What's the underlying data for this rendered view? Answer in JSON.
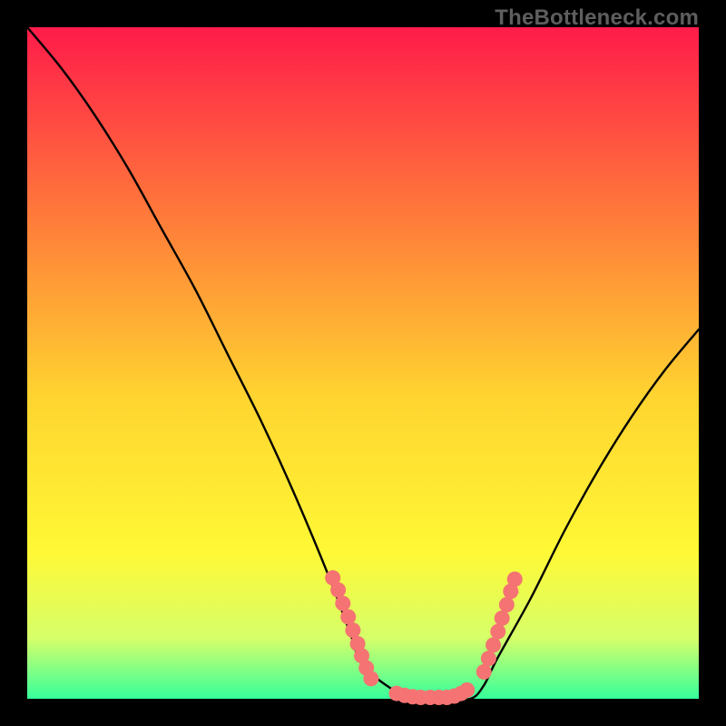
{
  "watermark": "TheBottleneck.com",
  "gradient": {
    "top": "#ff1b4a",
    "upper_mid": "#ff7a3a",
    "mid": "#ffd430",
    "lower_mid": "#fff835",
    "near_bottom": "#d6ff6a",
    "bottom": "#36ff9b"
  },
  "dot_color": "#f57373",
  "chart_data": {
    "type": "line",
    "title": "",
    "xlabel": "",
    "ylabel": "",
    "xlim": [
      0,
      100
    ],
    "ylim": [
      0,
      100
    ],
    "grid": false,
    "legend": false,
    "series": [
      {
        "name": "bottleneck_curve",
        "x": [
          0,
          5,
          10,
          15,
          20,
          25,
          30,
          35,
          40,
          45,
          48,
          50,
          55,
          58,
          60,
          62,
          66,
          68,
          70,
          75,
          80,
          85,
          90,
          95,
          100
        ],
        "y": [
          100,
          94,
          87,
          79,
          70,
          61,
          51,
          41,
          30,
          18,
          10,
          5,
          1,
          0,
          0,
          0,
          0,
          2,
          6,
          15,
          25,
          34,
          42,
          49,
          55
        ]
      }
    ],
    "dots_cluster_left": [
      {
        "x": 45.5,
        "y": 18.0
      },
      {
        "x": 46.3,
        "y": 16.2
      },
      {
        "x": 47.0,
        "y": 14.2
      },
      {
        "x": 47.8,
        "y": 12.2
      },
      {
        "x": 48.5,
        "y": 10.2
      },
      {
        "x": 49.2,
        "y": 8.2
      },
      {
        "x": 49.8,
        "y": 6.4
      },
      {
        "x": 50.5,
        "y": 4.6
      },
      {
        "x": 51.2,
        "y": 3.0
      }
    ],
    "dots_cluster_bottom": [
      {
        "x": 55.0,
        "y": 0.8
      },
      {
        "x": 56.2,
        "y": 0.5
      },
      {
        "x": 57.4,
        "y": 0.3
      },
      {
        "x": 58.6,
        "y": 0.2
      },
      {
        "x": 60.0,
        "y": 0.2
      },
      {
        "x": 61.3,
        "y": 0.2
      },
      {
        "x": 62.5,
        "y": 0.2
      },
      {
        "x": 63.6,
        "y": 0.4
      },
      {
        "x": 64.6,
        "y": 0.8
      },
      {
        "x": 65.5,
        "y": 1.3
      }
    ],
    "dots_cluster_right": [
      {
        "x": 68.0,
        "y": 4.0
      },
      {
        "x": 68.7,
        "y": 6.0
      },
      {
        "x": 69.4,
        "y": 8.0
      },
      {
        "x": 70.1,
        "y": 10.0
      },
      {
        "x": 70.7,
        "y": 12.0
      },
      {
        "x": 71.4,
        "y": 14.0
      },
      {
        "x": 72.0,
        "y": 16.0
      },
      {
        "x": 72.6,
        "y": 17.8
      }
    ]
  }
}
